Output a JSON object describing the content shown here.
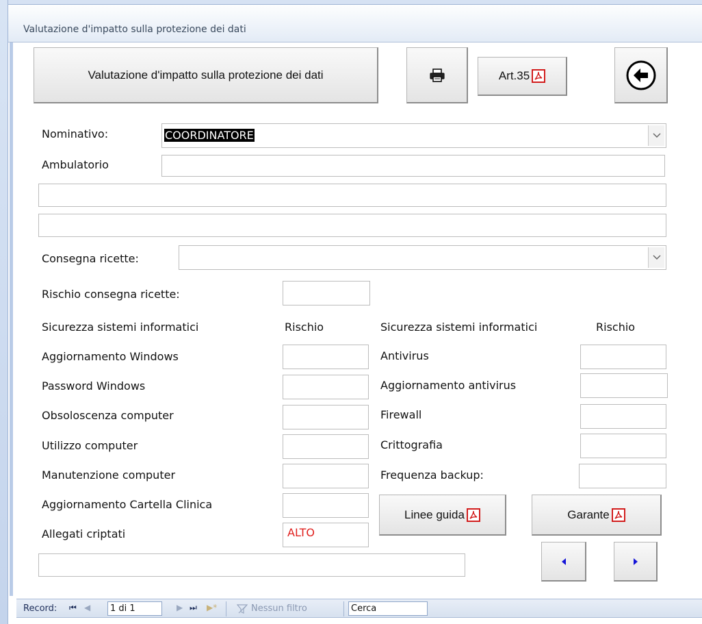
{
  "window": {
    "title": "Valutazione d'impatto sulla protezione dei dati"
  },
  "toolbar": {
    "main_label": "Valutazione d'impatto sulla protezione dei dati",
    "print_icon": "printer-icon",
    "art35_label": "Art.35",
    "back_icon": "back-arrow-icon"
  },
  "form": {
    "nominativo_label": "Nominativo:",
    "nominativo_value": "COORDINATORE",
    "ambulatorio_label": "Ambulatorio",
    "ambulatorio_value": "",
    "address1_value": "",
    "address2_value": "",
    "consegna_label": "Consegna ricette:",
    "consegna_value": "",
    "rischio_consegna_label": "Rischio consegna ricette:",
    "rischio_consegna_value": ""
  },
  "security": {
    "left_header": "Sicurezza sistemi informatici",
    "left_risk_header": "Rischio",
    "right_header": "Sicurezza sistemi informatici",
    "right_risk_header": "Rischio",
    "left_items": [
      {
        "label": "Aggiornamento Windows",
        "value": ""
      },
      {
        "label": "Password Windows",
        "value": ""
      },
      {
        "label": "Obsoloscenza computer",
        "value": ""
      },
      {
        "label": "Utilizzo computer",
        "value": ""
      },
      {
        "label": "Manutenzione computer",
        "value": ""
      },
      {
        "label": "Aggiornamento Cartella Clinica",
        "value": ""
      },
      {
        "label": "Allegati criptati",
        "value": "ALTO"
      }
    ],
    "right_items": [
      {
        "label": "Antivirus",
        "value": ""
      },
      {
        "label": "Aggiornamento antivirus",
        "value": ""
      },
      {
        "label": "Firewall",
        "value": ""
      },
      {
        "label": "Crittografia",
        "value": ""
      },
      {
        "label": "Frequenza backup:",
        "value": ""
      }
    ],
    "alert_color": "#e0201e"
  },
  "buttons": {
    "linee_guida": "Linee guida",
    "garante": "Garante"
  },
  "notes": {
    "value": ""
  },
  "statusbar": {
    "record_label": "Record:",
    "record_value": "1 di 1",
    "filter_label": "Nessun filtro",
    "search_value": "Cerca"
  }
}
